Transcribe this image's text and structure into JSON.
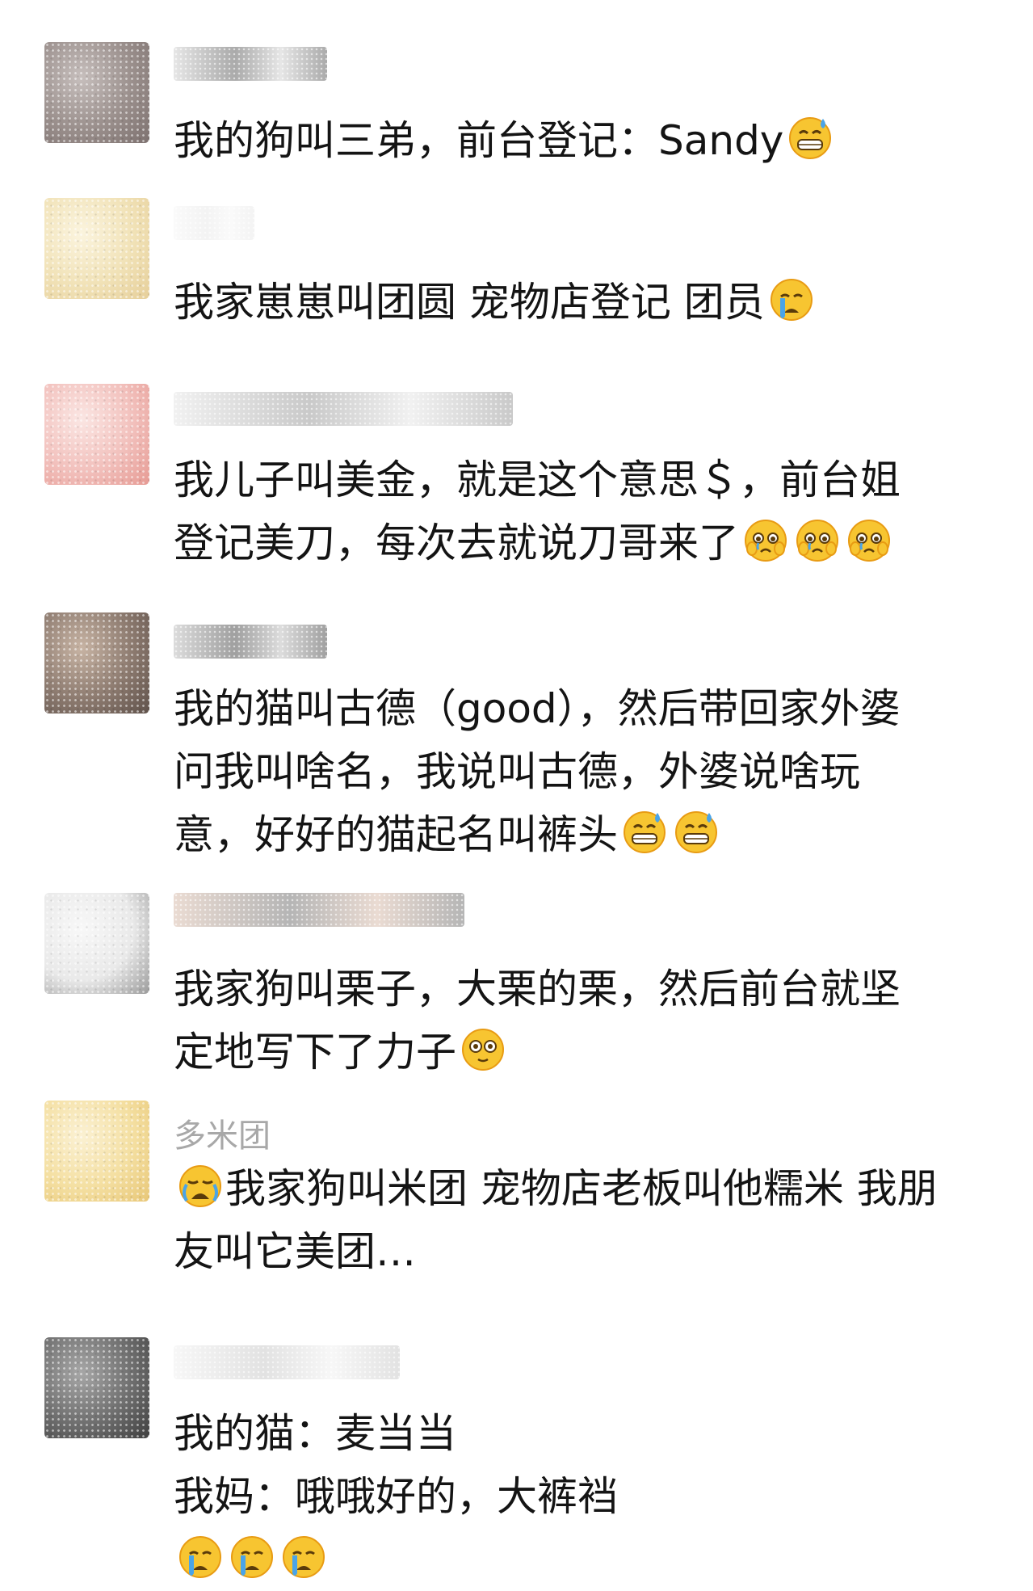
{
  "comments": [
    {
      "name": "",
      "lines": [
        "我的狗叫三弟，前台登记：Sandy"
      ],
      "line_emojis": [
        [
          "grin-sweat-emoji"
        ]
      ],
      "avatar_colors": [
        "#9a8f8c",
        "#c7bfbd",
        "#7d716f"
      ],
      "name_blur_colors": [
        "#aaaaaa",
        "#e6e6e6"
      ]
    },
    {
      "name": "",
      "lines": [
        "我家崽崽叫团圆 宠物店登记 团员"
      ],
      "line_emojis": [
        [
          "crying-emoji"
        ]
      ],
      "avatar_colors": [
        "#f1e2b7",
        "#fbf4de",
        "#e6cf9a"
      ],
      "name_blur_colors": [
        "#f3f3f3",
        "#fafafa"
      ]
    },
    {
      "name": "",
      "lines": [
        "我儿子叫美金，就是这个意思＄，前台姐",
        "登记美刀，每次去就说刀哥来了"
      ],
      "line_emojis": [
        [],
        [
          "pleading-tears-emoji",
          "pleading-tears-emoji",
          "pleading-tears-emoji"
        ]
      ],
      "avatar_colors": [
        "#f2c0bc",
        "#fbe6e3",
        "#e69a93"
      ],
      "name_blur_colors": [
        "#c9c9c9",
        "#f1f1f1"
      ]
    },
    {
      "name": "",
      "lines": [
        "我的猫叫古德（good），然后带回家外婆",
        "问我叫啥名，我说叫古德，外婆说啥玩",
        "意，好好的猫起名叫裤头"
      ],
      "line_emojis": [
        [],
        [],
        [
          "grin-sweat-emoji",
          "grin-sweat-emoji"
        ]
      ],
      "avatar_colors": [
        "#8c7a6f",
        "#c8b4a4",
        "#5f514a"
      ],
      "name_blur_colors": [
        "#9f9f9f",
        "#dcdcdc"
      ]
    },
    {
      "name": "",
      "lines": [
        "我家狗叫栗子，大栗的栗，然后前台就坚",
        "定地写下了力子"
      ],
      "line_emojis": [
        [],
        [
          "flushed-emoji"
        ]
      ],
      "avatar_colors": [
        "#e9e9e9",
        "#f8f8f8",
        "#9a9a9a"
      ],
      "name_blur_colors": [
        "#b5b5b5",
        "#eadbd2"
      ]
    },
    {
      "name": "多米团",
      "lines": [
        "我家狗叫米团 宠物店老板叫他糯米 我朋",
        "友叫它美团…"
      ],
      "line_emojis": [
        [
          "loudly-crying-emoji"
        ],
        []
      ],
      "leading_emoji_line": 0,
      "avatar_colors": [
        "#f4dfa1",
        "#fbf1d3",
        "#e8c777"
      ],
      "name_blur_colors": []
    },
    {
      "name": "",
      "lines": [
        "我的猫：麦当当",
        "我妈：哦哦好的，大裤裆",
        ""
      ],
      "line_emojis": [
        [],
        [],
        [
          "crying-emoji",
          "crying-emoji",
          "crying-emoji"
        ]
      ],
      "avatar_colors": [
        "#6e6e6e",
        "#a7a7a7",
        "#3f3f3f"
      ],
      "name_blur_colors": [
        "#e2e2e2",
        "#f7f7f7"
      ]
    }
  ],
  "colors": {
    "text": "#141414",
    "name": "#a8a8a8",
    "emoji_face": "#f7c531",
    "emoji_outline": "#e89b13",
    "tear": "#4aa4e8"
  }
}
